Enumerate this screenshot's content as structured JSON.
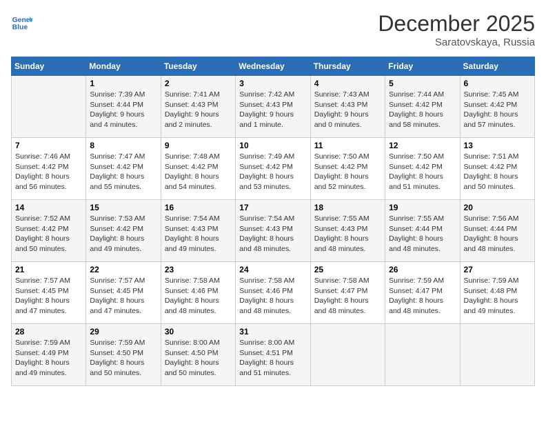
{
  "header": {
    "logo_line1": "General",
    "logo_line2": "Blue",
    "month": "December 2025",
    "location": "Saratovskaya, Russia"
  },
  "days_of_week": [
    "Sunday",
    "Monday",
    "Tuesday",
    "Wednesday",
    "Thursday",
    "Friday",
    "Saturday"
  ],
  "weeks": [
    [
      {
        "day": "",
        "info": ""
      },
      {
        "day": "1",
        "info": "Sunrise: 7:39 AM\nSunset: 4:44 PM\nDaylight: 9 hours\nand 4 minutes."
      },
      {
        "day": "2",
        "info": "Sunrise: 7:41 AM\nSunset: 4:43 PM\nDaylight: 9 hours\nand 2 minutes."
      },
      {
        "day": "3",
        "info": "Sunrise: 7:42 AM\nSunset: 4:43 PM\nDaylight: 9 hours\nand 1 minute."
      },
      {
        "day": "4",
        "info": "Sunrise: 7:43 AM\nSunset: 4:43 PM\nDaylight: 9 hours\nand 0 minutes."
      },
      {
        "day": "5",
        "info": "Sunrise: 7:44 AM\nSunset: 4:42 PM\nDaylight: 8 hours\nand 58 minutes."
      },
      {
        "day": "6",
        "info": "Sunrise: 7:45 AM\nSunset: 4:42 PM\nDaylight: 8 hours\nand 57 minutes."
      }
    ],
    [
      {
        "day": "7",
        "info": "Sunrise: 7:46 AM\nSunset: 4:42 PM\nDaylight: 8 hours\nand 56 minutes."
      },
      {
        "day": "8",
        "info": "Sunrise: 7:47 AM\nSunset: 4:42 PM\nDaylight: 8 hours\nand 55 minutes."
      },
      {
        "day": "9",
        "info": "Sunrise: 7:48 AM\nSunset: 4:42 PM\nDaylight: 8 hours\nand 54 minutes."
      },
      {
        "day": "10",
        "info": "Sunrise: 7:49 AM\nSunset: 4:42 PM\nDaylight: 8 hours\nand 53 minutes."
      },
      {
        "day": "11",
        "info": "Sunrise: 7:50 AM\nSunset: 4:42 PM\nDaylight: 8 hours\nand 52 minutes."
      },
      {
        "day": "12",
        "info": "Sunrise: 7:50 AM\nSunset: 4:42 PM\nDaylight: 8 hours\nand 51 minutes."
      },
      {
        "day": "13",
        "info": "Sunrise: 7:51 AM\nSunset: 4:42 PM\nDaylight: 8 hours\nand 50 minutes."
      }
    ],
    [
      {
        "day": "14",
        "info": "Sunrise: 7:52 AM\nSunset: 4:42 PM\nDaylight: 8 hours\nand 50 minutes."
      },
      {
        "day": "15",
        "info": "Sunrise: 7:53 AM\nSunset: 4:42 PM\nDaylight: 8 hours\nand 49 minutes."
      },
      {
        "day": "16",
        "info": "Sunrise: 7:54 AM\nSunset: 4:43 PM\nDaylight: 8 hours\nand 49 minutes."
      },
      {
        "day": "17",
        "info": "Sunrise: 7:54 AM\nSunset: 4:43 PM\nDaylight: 8 hours\nand 48 minutes."
      },
      {
        "day": "18",
        "info": "Sunrise: 7:55 AM\nSunset: 4:43 PM\nDaylight: 8 hours\nand 48 minutes."
      },
      {
        "day": "19",
        "info": "Sunrise: 7:55 AM\nSunset: 4:44 PM\nDaylight: 8 hours\nand 48 minutes."
      },
      {
        "day": "20",
        "info": "Sunrise: 7:56 AM\nSunset: 4:44 PM\nDaylight: 8 hours\nand 48 minutes."
      }
    ],
    [
      {
        "day": "21",
        "info": "Sunrise: 7:57 AM\nSunset: 4:45 PM\nDaylight: 8 hours\nand 47 minutes."
      },
      {
        "day": "22",
        "info": "Sunrise: 7:57 AM\nSunset: 4:45 PM\nDaylight: 8 hours\nand 47 minutes."
      },
      {
        "day": "23",
        "info": "Sunrise: 7:58 AM\nSunset: 4:46 PM\nDaylight: 8 hours\nand 48 minutes."
      },
      {
        "day": "24",
        "info": "Sunrise: 7:58 AM\nSunset: 4:46 PM\nDaylight: 8 hours\nand 48 minutes."
      },
      {
        "day": "25",
        "info": "Sunrise: 7:58 AM\nSunset: 4:47 PM\nDaylight: 8 hours\nand 48 minutes."
      },
      {
        "day": "26",
        "info": "Sunrise: 7:59 AM\nSunset: 4:47 PM\nDaylight: 8 hours\nand 48 minutes."
      },
      {
        "day": "27",
        "info": "Sunrise: 7:59 AM\nSunset: 4:48 PM\nDaylight: 8 hours\nand 49 minutes."
      }
    ],
    [
      {
        "day": "28",
        "info": "Sunrise: 7:59 AM\nSunset: 4:49 PM\nDaylight: 8 hours\nand 49 minutes."
      },
      {
        "day": "29",
        "info": "Sunrise: 7:59 AM\nSunset: 4:50 PM\nDaylight: 8 hours\nand 50 minutes."
      },
      {
        "day": "30",
        "info": "Sunrise: 8:00 AM\nSunset: 4:50 PM\nDaylight: 8 hours\nand 50 minutes."
      },
      {
        "day": "31",
        "info": "Sunrise: 8:00 AM\nSunset: 4:51 PM\nDaylight: 8 hours\nand 51 minutes."
      },
      {
        "day": "",
        "info": ""
      },
      {
        "day": "",
        "info": ""
      },
      {
        "day": "",
        "info": ""
      }
    ]
  ]
}
